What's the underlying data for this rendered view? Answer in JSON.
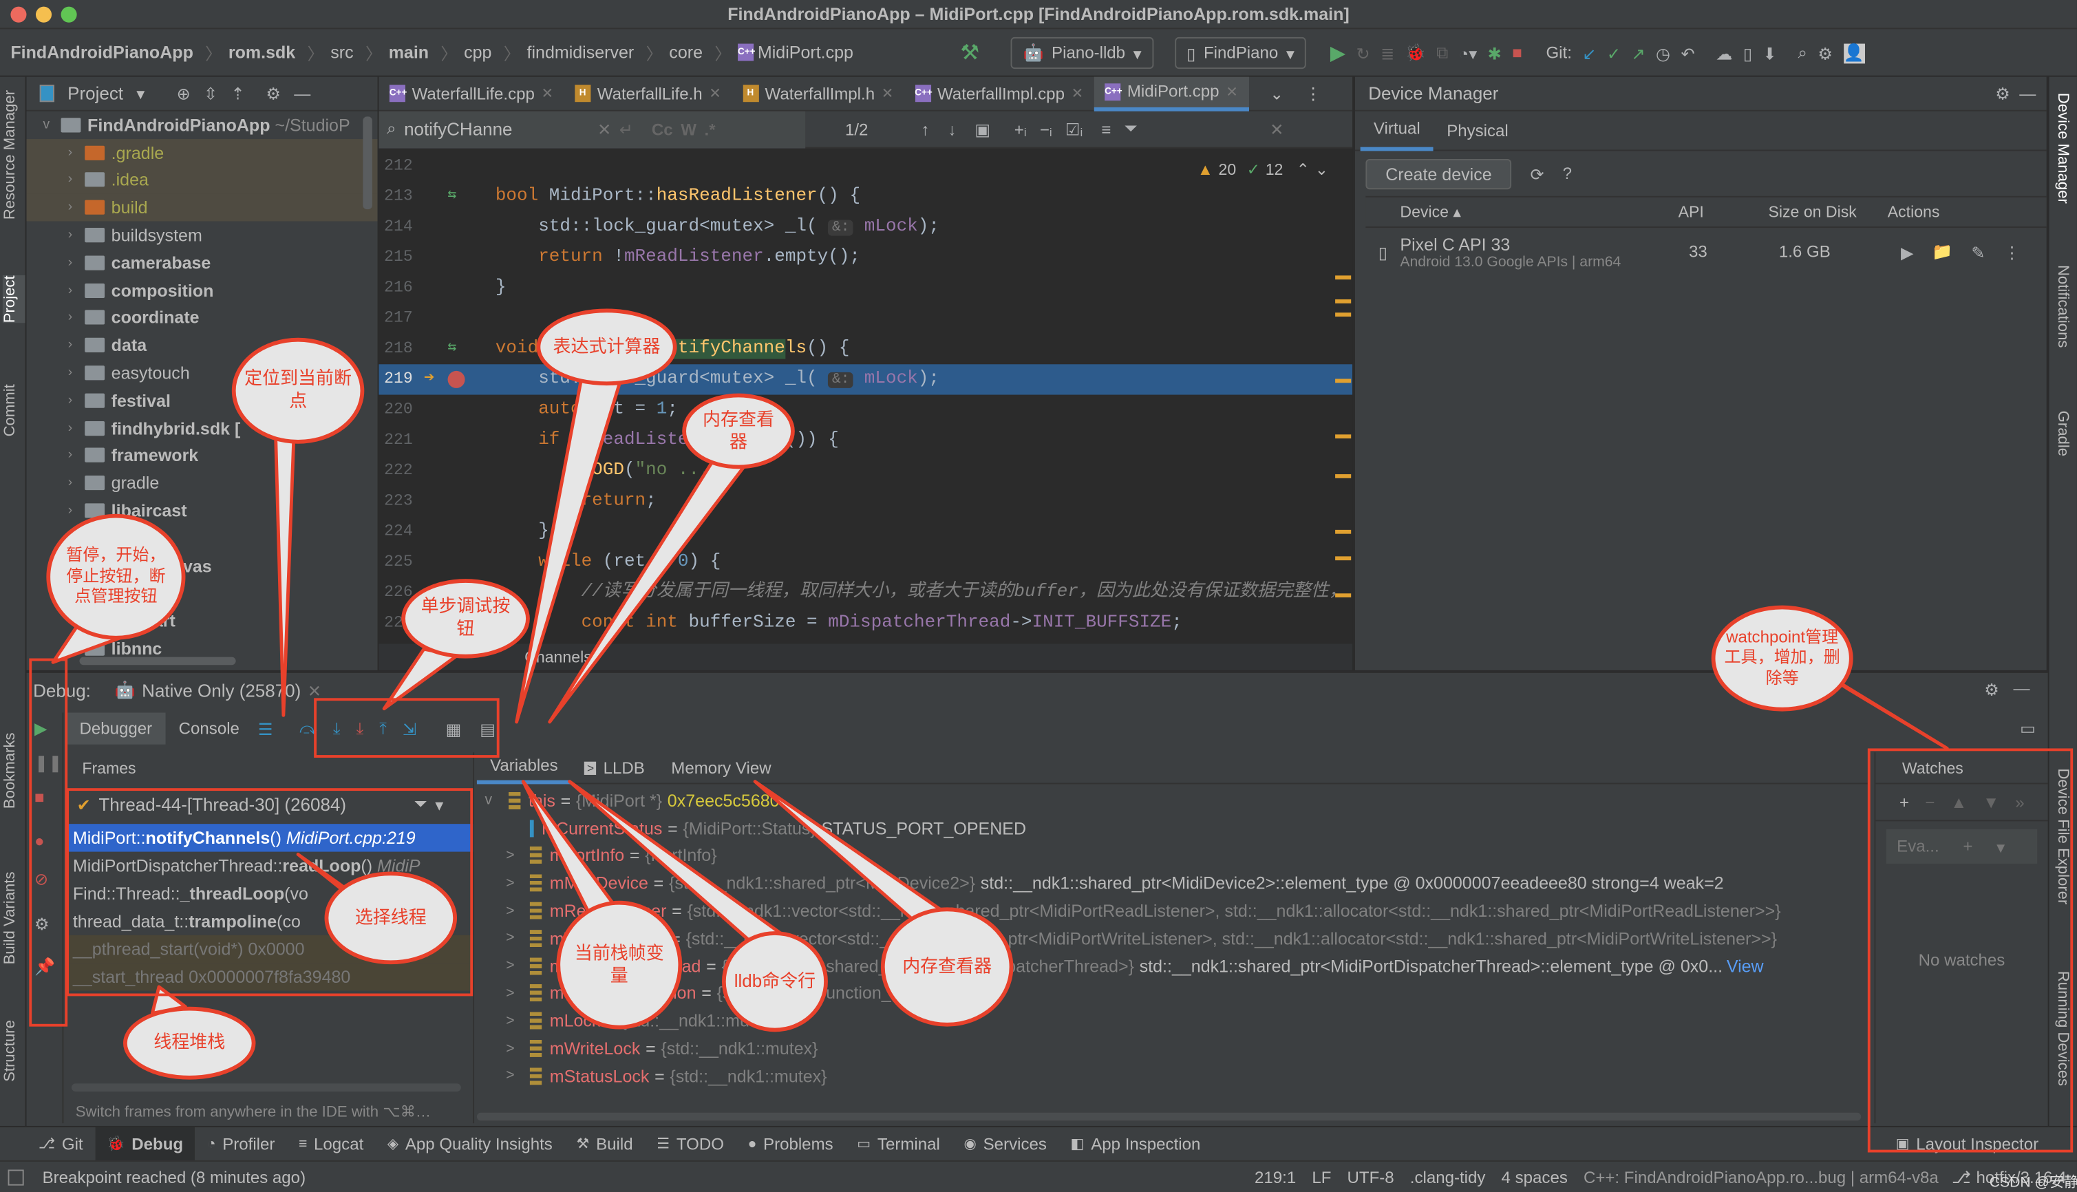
{
  "window": {
    "title": "FindAndroidPianoApp – MidiPort.cpp [FindAndroidPianoApp.rom.sdk.main]"
  },
  "breadcrumb": [
    "FindAndroidPianoApp",
    "rom.sdk",
    "src",
    "main",
    "cpp",
    "findmidiserver",
    "core",
    "MidiPort.cpp"
  ],
  "toolbar": {
    "run_config": "Piano-lldb",
    "device": "FindPiano",
    "git_label": "Git:"
  },
  "left_strip": [
    "Resource Manager",
    "Project",
    "Commit",
    "Bookmarks",
    "Build Variants",
    "Structure"
  ],
  "right_strip": [
    "Device Manager",
    "Notifications",
    "Gradle",
    "Device File Explorer",
    "Running Devices"
  ],
  "project": {
    "title": "Project",
    "root": "FindAndroidPianoApp",
    "root_path": "~/StudioP",
    "items": [
      {
        "label": ".gradle",
        "color": "#a9a84f",
        "type": "orange"
      },
      {
        "label": ".idea",
        "color": "#a9a84f",
        "type": "gray"
      },
      {
        "label": "build",
        "color": "#a9a84f",
        "type": "orange"
      },
      {
        "label": "buildsystem",
        "color": "#bbbbbb",
        "type": "gray"
      },
      {
        "label": "camerabase",
        "color": "#bbbbbb",
        "type": "module"
      },
      {
        "label": "composition",
        "color": "#bbbbbb",
        "type": "module"
      },
      {
        "label": "coordinate",
        "color": "#bbbbbb",
        "type": "module"
      },
      {
        "label": "data",
        "color": "#bbbbbb",
        "type": "module"
      },
      {
        "label": "easytouch",
        "color": "#bbbbbb",
        "type": "gray"
      },
      {
        "label": "festival",
        "color": "#bbbbbb",
        "type": "module"
      },
      {
        "label": "findhybrid.sdk [",
        "color": "#bbbbbb",
        "type": "module"
      },
      {
        "label": "framework",
        "color": "#bbbbbb",
        "type": "module"
      },
      {
        "label": "gradle",
        "color": "#bbbbbb",
        "type": "gray"
      },
      {
        "label": "libaircast",
        "color": "#bbbbbb",
        "type": "module"
      },
      {
        "label": "…let",
        "color": "#bbbbbb",
        "type": "module"
      },
      {
        "label": "…blecanvas",
        "color": "#bbbbbb",
        "type": "module"
      },
      {
        "label": "",
        "color": "#bbbbbb",
        "type": "module"
      },
      {
        "label": "…smart",
        "color": "#bbbbbb",
        "type": "module"
      },
      {
        "label": "libnnc",
        "color": "#bbbbbb",
        "type": "module"
      }
    ]
  },
  "editor": {
    "tabs": [
      {
        "label": "WaterfallLife.cpp",
        "kind": "C++"
      },
      {
        "label": "WaterfallLife.h",
        "kind": "H"
      },
      {
        "label": "WaterfallImpl.h",
        "kind": "H"
      },
      {
        "label": "WaterfallImpl.cpp",
        "kind": "C++"
      },
      {
        "label": "MidiPort.cpp",
        "kind": "C++",
        "active": true
      }
    ],
    "find": {
      "query": "notifyCHanne",
      "match": "1/2",
      "cc": "Cc",
      "w": "W",
      "regex": ".*"
    },
    "inspections": {
      "warnings": "20",
      "ok": "12"
    },
    "lines": [
      {
        "n": "212",
        "html": ""
      },
      {
        "n": "213",
        "html": "<span class='kw'>bool</span> MidiPort::<span class='fn'>hasReadListener</span>() {"
      },
      {
        "n": "214",
        "html": "    std::lock_guard&lt;mutex&gt; _l( <span class='hint'>&amp;:</span> <span class='fld'>mLock</span>);"
      },
      {
        "n": "215",
        "html": "    <span class='kw'>return</span> !<span class='fld'>mReadListener</span>.empty();"
      },
      {
        "n": "216",
        "html": "}"
      },
      {
        "n": "217",
        "html": ""
      },
      {
        "n": "218",
        "html": "<span class='kw'>void</span> MidiPort::<span class='fn' style='background:#32593d'>notifyChanne</span><span class='fn'>ls</span>() {"
      },
      {
        "n": "219",
        "html": "    std::lock_guard&lt;mutex&gt; _l( <span class='hint'>&amp;:</span> <span class='fld'>mLock</span>);"
      },
      {
        "n": "220",
        "html": "    <span class='kw'>auto</span> ret = <span style='color:#6897bb'>1</span>;"
      },
      {
        "n": "221",
        "html": "    <span class='kw'>if</span> (<span class='fld'>mReadListener</span>.empty()) {"
      },
      {
        "n": "222",
        "html": "        <span class='fn'>LOGD</span>(<span class='str'>\"no ...\"</span>);"
      },
      {
        "n": "223",
        "html": "        <span class='kw'>return</span>;"
      },
      {
        "n": "224",
        "html": "    }"
      },
      {
        "n": "225",
        "html": "    <span class='kw'>while</span> (ret &gt; <span style='color:#6897bb'>0</span>) {"
      },
      {
        "n": "226",
        "html": "        <span class='cm'>//读写分发属于同一线程，取同样大小，或者大于读的buffer，因为此处没有保证数据完整性，</span>"
      },
      {
        "n": "227",
        "html": "        <span class='kw'>const int</span> bufferSize = <span class='fld'>mDispatcherThread</span>-&gt;<span class='fld'>INIT_BUFFSIZE</span>;"
      }
    ],
    "breadcrumb_footer": "Channels"
  },
  "device_manager": {
    "title": "Device Manager",
    "tabs": [
      "Virtual",
      "Physical"
    ],
    "create": "Create device",
    "columns": [
      "Device",
      "API",
      "Size on Disk",
      "Actions"
    ],
    "devices": [
      {
        "name": "Pixel C API 33",
        "detail": "Android 13.0 Google APIs | arm64",
        "api": "33",
        "size": "1.6 GB"
      }
    ]
  },
  "debug": {
    "label": "Debug:",
    "session": "Native Only (25870)",
    "tabs": [
      "Debugger",
      "Console"
    ],
    "frames_title": "Frames",
    "thread": "Thread-44-[Thread-30] (26084)",
    "frames": [
      {
        "fn": "MidiPort::",
        "bold": "notifyChannels",
        "rest": "() ",
        "loc": "MidiPort.cpp:219",
        "selected": true
      },
      {
        "fn": "MidiPortDispatcherThread::",
        "bold": "readLoop",
        "rest": "() ",
        "loc": "MidiP"
      },
      {
        "fn": "Find::Thread::",
        "bold": "_threadLoop",
        "rest": "(vo",
        "loc": ""
      },
      {
        "fn": "thread_data_t::",
        "bold": "trampoline",
        "rest": "(co",
        "loc": ""
      },
      {
        "fn": "__pthread_start(void*) ",
        "bold": "",
        "rest": "0x0000",
        "loc": "",
        "dim": true
      },
      {
        "fn": "__start_thread ",
        "bold": "",
        "rest": "0x0000007f8fa39480",
        "loc": "",
        "dim": true
      }
    ],
    "frames_hint": "Switch frames from anywhere in the IDE with ⌥⌘…",
    "var_tabs": [
      "Variables",
      "LLDB",
      "Memory View"
    ],
    "variables": [
      {
        "expand": "v",
        "name": "this",
        "type": "{MidiPort *}",
        "value": "0x7eec5c5680",
        "yellow": true,
        "indent": 0
      },
      {
        "expand": "",
        "name": "mCurrentStatus",
        "type": "{MidiPort::Status}",
        "value": "STATUS_PORT_OPENED",
        "indent": 1
      },
      {
        "expand": ">",
        "name": "mPortInfo",
        "type": "{PortInfo}",
        "value": "",
        "indent": 1
      },
      {
        "expand": ">",
        "name": "mMidiDevice",
        "type": "{std::__ndk1::shared_ptr<MidiDevice2>}",
        "value": "std::__ndk1::shared_ptr<MidiDevice2>::element_type @ 0x0000007eeadeee80 strong=4 weak=2",
        "indent": 1
      },
      {
        "expand": ">",
        "name": "mReadListener",
        "type": "{std::__ndk1::vector<std::__ndk1::shared_ptr<MidiPortReadListener>, std::__ndk1::allocator<std::__ndk1::shared_ptr<MidiPortReadListener>>}",
        "value": "",
        "indent": 1
      },
      {
        "expand": ">",
        "name": "mWriteListener",
        "type": "{std::__ndk1::vector<std::__ndk1::shared_ptr<MidiPortWriteListener>, std::__ndk1::allocator<std::__ndk1::shared_ptr<MidiPortWriteListener>>}",
        "value": "",
        "indent": 1
      },
      {
        "expand": ">",
        "name": "mDispatcherThread",
        "type": "{std::__ndk1::shared_ptr<MidiPortDispatcherThread>}",
        "value": "std::__ndk1::shared_ptr<MidiPortDispatcherThread>::element_type @ 0x0...",
        "link": "View",
        "indent": 1
      },
      {
        "expand": ">",
        "name": "mCallbackFunction",
        "type": "{std::__ndk1::function_v...}",
        "value": "",
        "indent": 1
      },
      {
        "expand": ">",
        "name": "mLock",
        "type": "{std::__ndk1::mutex}",
        "value": "",
        "indent": 1
      },
      {
        "expand": ">",
        "name": "mWriteLock",
        "type": "{std::__ndk1::mutex}",
        "value": "",
        "indent": 1
      },
      {
        "expand": ">",
        "name": "mStatusLock",
        "type": "{std::__ndk1::mutex}",
        "value": "",
        "indent": 1
      }
    ],
    "watches_title": "Watches",
    "watch_placeholder": "Eva...",
    "no_watches": "No watches"
  },
  "bottom_tabs": [
    "Git",
    "Debug",
    "Profiler",
    "Logcat",
    "App Quality Insights",
    "Build",
    "TODO",
    "Problems",
    "Terminal",
    "Services",
    "App Inspection",
    "Layout Inspector"
  ],
  "status": {
    "message": "Breakpoint reached (8 minutes ago)",
    "position": "219:1",
    "line_sep": "LF",
    "encoding": "UTF-8",
    "linter": ".clang-tidy",
    "indent": "4 spaces",
    "context": "C++: FindAndroidPianoApp.ro...bug | arm64-v8a",
    "branch": "hotfix/3.16.4",
    "watermark": "CSDN @安静的猫人"
  },
  "annotations": {
    "locate": "定位到当前断点",
    "expr": "表达式计算器",
    "mem1": "内存查看器",
    "pause": "暂停，开始，停止按钮，断点管理按钮",
    "step": "单步调试按钮",
    "thread": "选择线程",
    "stack": "线程堆栈",
    "frame_vars": "当前栈帧变量",
    "lldb": "lldb命令行",
    "mem2": "内存查看器",
    "watch": "watchpoint管理工具，增加，删除等"
  },
  "colors": {
    "annotation": "#e8412b",
    "accent": "#4a88c7",
    "selection": "#2f65ca",
    "exec_line": "#2d5b8c"
  }
}
